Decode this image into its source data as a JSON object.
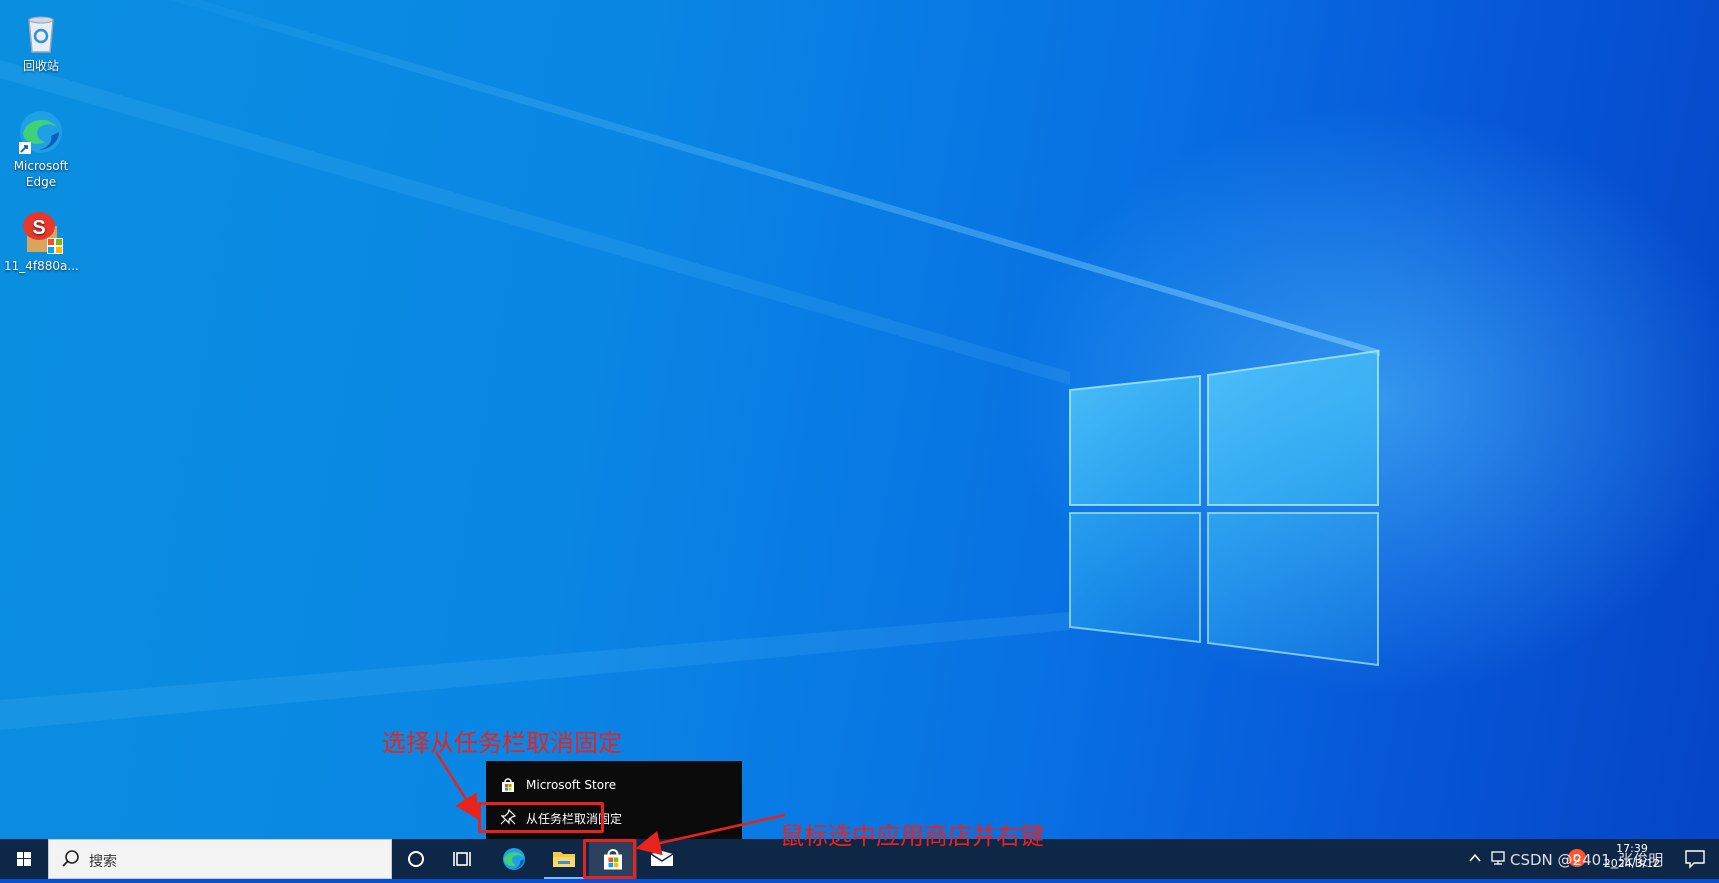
{
  "desktop": {
    "icons": [
      {
        "label": "回收站",
        "icon": "recycle-bin-icon"
      },
      {
        "label": "Microsoft Edge",
        "icon": "edge-icon"
      },
      {
        "label": "11_4f880a...",
        "icon": "sogou-app-icon"
      }
    ]
  },
  "context_menu": {
    "items": [
      {
        "label": "Microsoft Store",
        "icon": "store-icon"
      },
      {
        "label": "从任务栏取消固定",
        "icon": "unpin-icon"
      }
    ]
  },
  "taskbar": {
    "search_placeholder": "搜索",
    "apps": [
      "cortana-icon",
      "task-view-icon",
      "edge-icon",
      "file-explorer-icon",
      "microsoft-store-icon",
      "mail-icon"
    ],
    "tray_overlay": "CSDN @2401_张俊明",
    "clock": {
      "time": "17:39",
      "date": "2024/3/12"
    }
  },
  "annotations": {
    "top": "选择从任务栏取消固定",
    "right": "鼠标选中应用商店并右键"
  },
  "colors": {
    "taskbar": "#0f2747",
    "annotation_red": "#e8231b",
    "menu_bg": "#0b0b0b"
  }
}
